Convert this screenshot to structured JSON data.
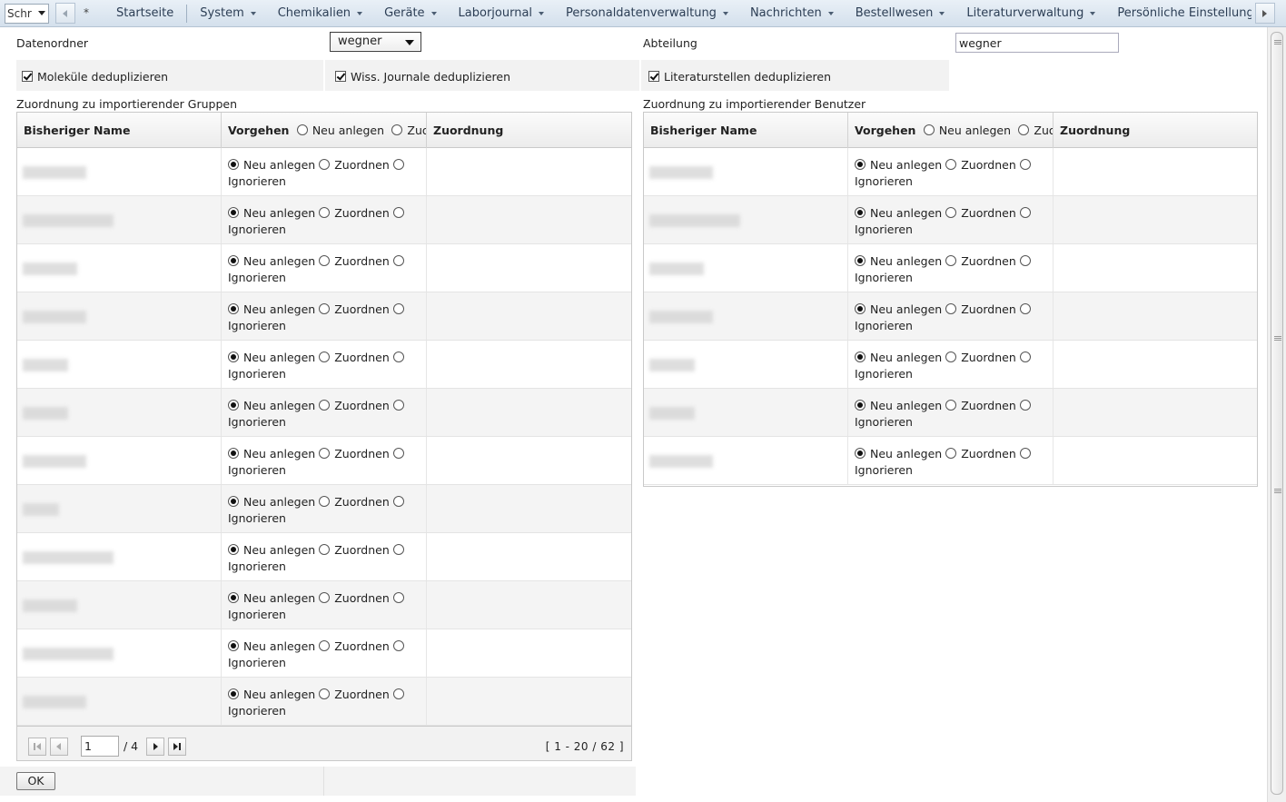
{
  "nav": {
    "font_select_value": "Schr",
    "star": "*",
    "items": [
      {
        "label": "Startseite",
        "has_menu": false
      },
      {
        "label": "System",
        "has_menu": true
      },
      {
        "label": "Chemikalien",
        "has_menu": true
      },
      {
        "label": "Geräte",
        "has_menu": true
      },
      {
        "label": "Laborjournal",
        "has_menu": true
      },
      {
        "label": "Personaldatenverwaltung",
        "has_menu": true
      },
      {
        "label": "Nachrichten",
        "has_menu": true
      },
      {
        "label": "Bestellwesen",
        "has_menu": true
      },
      {
        "label": "Literaturverwaltung",
        "has_menu": true
      },
      {
        "label": "Persönliche Einstellungen",
        "has_menu": false
      },
      {
        "label": "A",
        "has_menu": false
      }
    ]
  },
  "form": {
    "datenordner_label": "Datenordner",
    "datenordner_value": "wegner",
    "abteilung_label": "Abteilung",
    "abteilung_value": "wegner",
    "dedup": [
      {
        "label": "Moleküle deduplizieren",
        "checked": true
      },
      {
        "label": "Wiss. Journale deduplizieren",
        "checked": true
      },
      {
        "label": "Literaturstellen deduplizieren",
        "checked": true
      }
    ]
  },
  "groups": {
    "title": "Zuordnung zu importierender Gruppen",
    "col_name": "Bisheriger Name",
    "col_action": "Vorgehen",
    "header_opt_new": "Neu anlegen",
    "header_opt_assign": "Zuordnen",
    "col_assign": "Zuordnung",
    "row_count": 12,
    "pager": {
      "page": "1",
      "total": "/ 4",
      "range": "[ 1 - 20 / 62 ]"
    }
  },
  "users": {
    "title": "Zuordnung zu importierender Benutzer",
    "col_name": "Bisheriger Name",
    "col_action": "Vorgehen",
    "header_opt_new": "Neu anlegen",
    "header_opt_assign": "Zuordnen",
    "col_assign": "Zuordnung",
    "row_count": 7
  },
  "row_options": {
    "new": "Neu anlegen",
    "assign": "Zuordnen",
    "ignore": "Ignorieren",
    "selected": "new"
  },
  "ok_label": "OK"
}
